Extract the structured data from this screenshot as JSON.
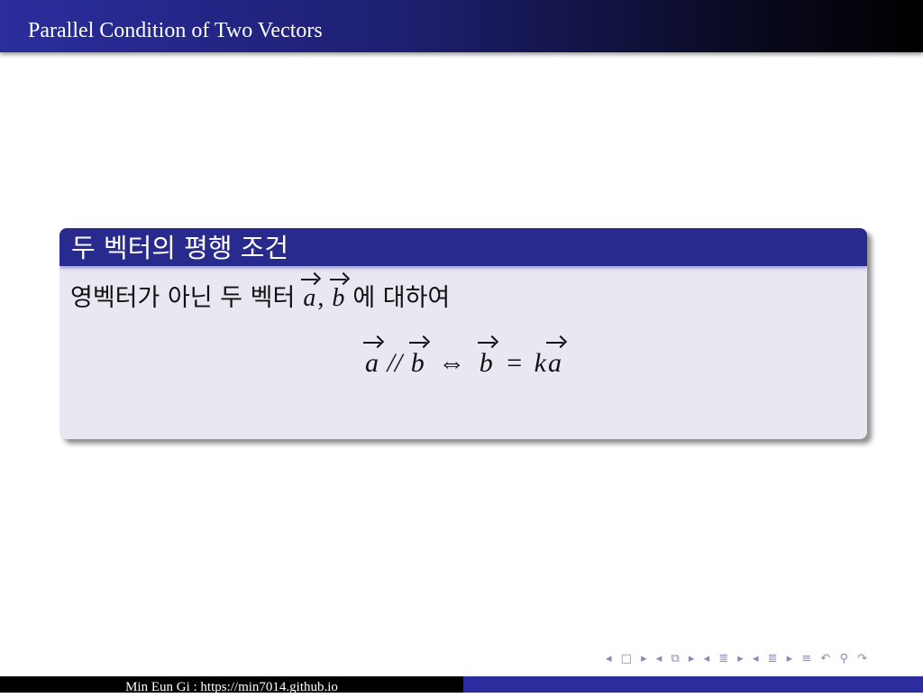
{
  "header": {
    "title": "Parallel Condition of Two Vectors"
  },
  "block": {
    "title": "두 벡터의 평행 조건",
    "line_prefix": "영벡터가 아닌 두 벡터",
    "vec_a": "a",
    "comma": ",",
    "vec_b": "b",
    "line_suffix": "에 대하여",
    "formula": {
      "a1": "a",
      "parallel": "//",
      "b1": "b",
      "iff": "⇔",
      "b2": "b",
      "equals": "=",
      "k": "k",
      "a2": "a"
    }
  },
  "nav": {
    "icons": [
      "◂",
      "□",
      "▸",
      "◂",
      "⧉",
      "▸",
      "◂",
      "≣",
      "▸",
      "◂",
      "≣",
      "▸",
      "≡",
      "↶",
      "⚲",
      "↷"
    ]
  },
  "footer": {
    "text": "Min Eun Gi : https://min7014.github.io"
  },
  "colors": {
    "header_start": "#2b2d9e",
    "block_head": "#282a8e",
    "block_body": "#e8e8f2",
    "footer_right": "#2b2d9e"
  }
}
